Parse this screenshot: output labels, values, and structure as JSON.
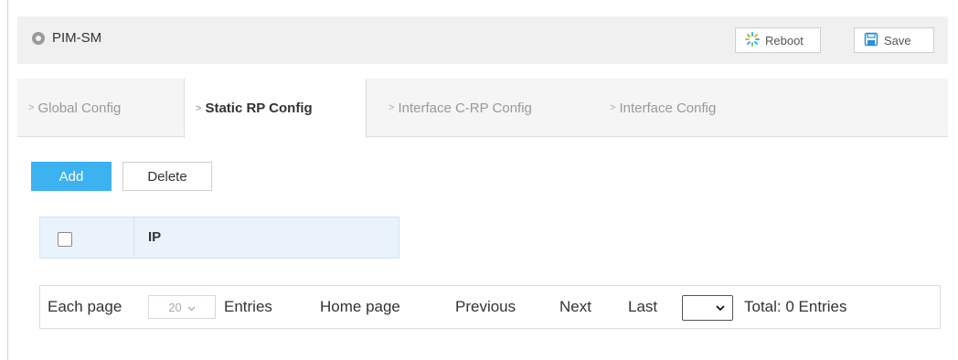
{
  "header": {
    "title": "PIM-SM",
    "reboot_label": "Reboot",
    "save_label": "Save"
  },
  "tabs": [
    {
      "label": "Global Config"
    },
    {
      "label": "Static RP Config"
    },
    {
      "label": "Interface C-RP Config"
    },
    {
      "label": "Interface Config"
    }
  ],
  "actions": {
    "add_label": "Add",
    "delete_label": "Delete"
  },
  "table": {
    "columns": [
      "",
      "IP"
    ],
    "rows": []
  },
  "pager": {
    "each_page_label": "Each page",
    "page_size": "20",
    "entries_label": "Entries",
    "home_label": "Home page",
    "previous_label": "Previous",
    "next_label": "Next",
    "last_label": "Last",
    "total_label": "Total: 0 Entries"
  },
  "colors": {
    "accent": "#3db2f0",
    "header_bg": "#f0f0f0",
    "table_head_bg": "#eaf3fb"
  }
}
